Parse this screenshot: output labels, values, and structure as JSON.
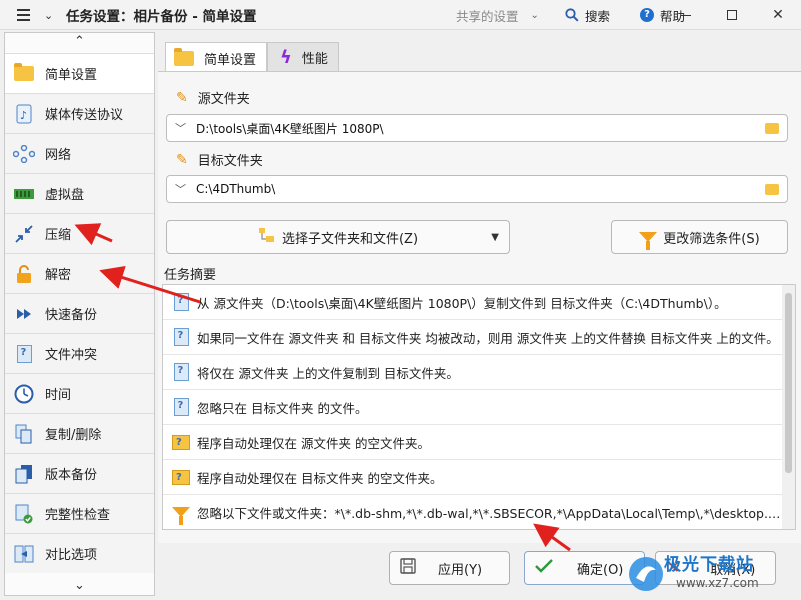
{
  "titlebar": {
    "title": "任务设置：相片备份 - 简单设置",
    "shared_settings": "共享的设置",
    "search": "搜索",
    "help": "帮助",
    "close_glyph": "✕"
  },
  "sidebar": {
    "items": [
      {
        "label": "简单设置",
        "icon": "folder-icon"
      },
      {
        "label": "媒体传送协议",
        "icon": "media-device-icon"
      },
      {
        "label": "网络",
        "icon": "network-icon"
      },
      {
        "label": "虚拟盘",
        "icon": "virtual-disk-icon"
      },
      {
        "label": "压缩",
        "icon": "compress-icon"
      },
      {
        "label": "解密",
        "icon": "lock-icon"
      },
      {
        "label": "快速备份",
        "icon": "fast-forward-icon"
      },
      {
        "label": "文件冲突",
        "icon": "file-conflict-icon"
      },
      {
        "label": "时间",
        "icon": "clock-icon"
      },
      {
        "label": "复制/删除",
        "icon": "copy-delete-icon"
      },
      {
        "label": "版本备份",
        "icon": "versions-icon"
      },
      {
        "label": "完整性检查",
        "icon": "integrity-check-icon"
      },
      {
        "label": "对比选项",
        "icon": "compare-icon"
      }
    ]
  },
  "tabs": [
    {
      "label": "简单设置",
      "icon": "folder-icon",
      "active": true
    },
    {
      "label": "性能",
      "icon": "lightning-icon",
      "active": false
    }
  ],
  "source": {
    "label": "源文件夹",
    "path": "D:\\tools\\桌面\\4K壁纸图片 1080P\\"
  },
  "target": {
    "label": "目标文件夹",
    "path": "C:\\4DThumb\\"
  },
  "buttons": {
    "select_subfolders": "选择子文件夹和文件(Z)",
    "change_filter": "更改筛选条件(S)",
    "apply": "应用(Y)",
    "ok": "确定(O)",
    "cancel": "取消(X)"
  },
  "summary": {
    "label": "任务摘要",
    "rows": [
      {
        "icon": "info-doc-icon",
        "text": "从 源文件夹（D:\\tools\\桌面\\4K壁纸图片 1080P\\）复制文件到 目标文件夹（C:\\4DThumb\\）。"
      },
      {
        "icon": "info-doc-icon",
        "text": "如果同一文件在 源文件夹 和 目标文件夹 均被改动，则用 源文件夹 上的文件替换 目标文件夹 上的文件。"
      },
      {
        "icon": "info-doc-icon",
        "text": "将仅在 源文件夹 上的文件复制到 目标文件夹。"
      },
      {
        "icon": "info-doc-icon",
        "text": "忽略只在 目标文件夹 的文件。"
      },
      {
        "icon": "folder-info-icon",
        "text": "程序自动处理仅在 源文件夹 的空文件夹。"
      },
      {
        "icon": "folder-info-icon",
        "text": "程序自动处理仅在 目标文件夹 的空文件夹。"
      },
      {
        "icon": "filter-icon",
        "text": "忽略以下文件或文件夹：*\\*.db-shm,*\\*.db-wal,*\\*.SBSECOR,*\\AppData\\Local\\Temp\\,*\\desktop.ini,*\\DfsrPrivate\\"
      }
    ]
  },
  "watermark": {
    "name": "极光下载站",
    "url": "www.xz7.com"
  },
  "colors": {
    "accent": "#1f6fd1",
    "folder": "#f6c342",
    "annotation_arrow": "#e0211d"
  }
}
